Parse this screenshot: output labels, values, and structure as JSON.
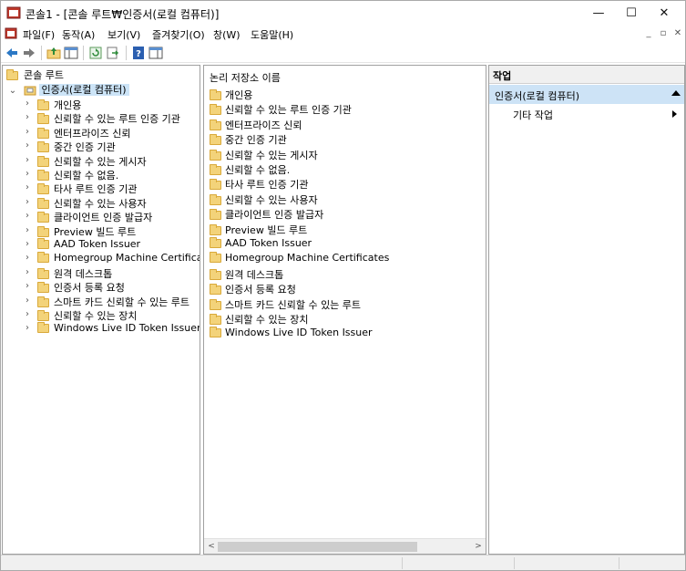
{
  "window": {
    "title": "콘솔1 - [콘솔 루트₩인증서(로컬 컴퓨터)]",
    "minimize_label": "—",
    "maximize_label": "☐",
    "close_label": "✕"
  },
  "menu": {
    "items": [
      "파일(F)",
      "동작(A)",
      "보기(V)",
      "즐겨찾기(O)",
      "창(W)",
      "도움말(H)"
    ],
    "mdi_min": "_",
    "mdi_restore": "▫",
    "mdi_close": "✕"
  },
  "toolbar": {
    "buttons": [
      "back-icon",
      "forward-icon",
      "up-folder-icon",
      "show-hide-tree-icon",
      "refresh-icon",
      "export-list-icon",
      "help-icon",
      "show-hide-action-icon"
    ]
  },
  "tree": {
    "root_label": "콘솔 루트",
    "node_label": "인증서(로컬 컴퓨터)",
    "items": [
      "개인용",
      "신뢰할 수 있는 루트 인증 기관",
      "엔터프라이즈 신뢰",
      "중간 인증 기관",
      "신뢰할 수 있는 게시자",
      "신뢰할 수 없음.",
      "타사 루트 인증 기관",
      "신뢰할 수 있는 사용자",
      "클라이언트 인증 발급자",
      "Preview 빌드 루트",
      "AAD Token Issuer",
      "Homegroup Machine Certificates",
      "원격 데스크톱",
      "인증서 등록 요청",
      "스마트 카드 신뢰할 수 있는 루트",
      "신뢰할 수 있는 장치",
      "Windows Live ID Token Issuer"
    ]
  },
  "list": {
    "column_header": "논리 저장소 이름",
    "items": [
      "개인용",
      "신뢰할 수 있는 루트 인증 기관",
      "엔터프라이즈 신뢰",
      "중간 인증 기관",
      "신뢰할 수 있는 게시자",
      "신뢰할 수 없음.",
      "타사 루트 인증 기관",
      "신뢰할 수 있는 사용자",
      "클라이언트 인증 발급자",
      "Preview 빌드 루트",
      "AAD Token Issuer",
      "Homegroup Machine Certificates",
      "원격 데스크톱",
      "인증서 등록 요청",
      "스마트 카드 신뢰할 수 있는 루트",
      "신뢰할 수 있는 장치",
      "Windows Live ID Token Issuer"
    ]
  },
  "actions": {
    "header": "작업",
    "section_label": "인증서(로컬 컴퓨터)",
    "more_actions": "기타 작업"
  },
  "colors": {
    "selection": "#cce4f7",
    "action_section": "#cde3f6",
    "folder": "#f3d37a"
  }
}
